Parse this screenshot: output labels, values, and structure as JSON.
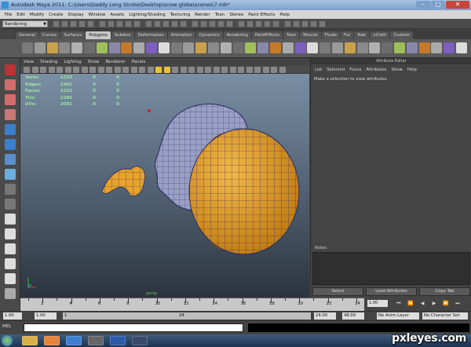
{
  "window": {
    "title": "Autodesk Maya 2011: C:\\Users\\Daddy Long Stroke\\Desktop\\snow globe\\scenes\\7.mb*",
    "minimize": "–",
    "maximize": "▢",
    "close": "✕"
  },
  "menubar": [
    "File",
    "Edit",
    "Modify",
    "Create",
    "Display",
    "Window",
    "Assets",
    "Lighting/Shading",
    "Texturing",
    "Render",
    "Toon",
    "Stereo",
    "Paint Effects",
    "Help"
  ],
  "statusline": {
    "mode": "Rendering"
  },
  "shelf_tabs": [
    {
      "label": "General",
      "active": false
    },
    {
      "label": "Curves",
      "active": false
    },
    {
      "label": "Surfaces",
      "active": false
    },
    {
      "label": "Polygons",
      "active": true
    },
    {
      "label": "Subdivs",
      "active": false
    },
    {
      "label": "Deformation",
      "active": false
    },
    {
      "label": "Animation",
      "active": false
    },
    {
      "label": "Dynamics",
      "active": false
    },
    {
      "label": "Rendering",
      "active": false
    },
    {
      "label": "PaintEffects",
      "active": false
    },
    {
      "label": "Toon",
      "active": false
    },
    {
      "label": "Muscle",
      "active": false
    },
    {
      "label": "Fluids",
      "active": false
    },
    {
      "label": "Fur",
      "active": false
    },
    {
      "label": "Hair",
      "active": false
    },
    {
      "label": "nCloth",
      "active": false
    },
    {
      "label": "Custom",
      "active": false
    }
  ],
  "panel_menu": [
    "View",
    "Shading",
    "Lighting",
    "Show",
    "Renderer",
    "Panels"
  ],
  "hud": [
    {
      "label": "Verts:",
      "v1": "1220",
      "v2": "0",
      "v3": "0"
    },
    {
      "label": "Edges:",
      "v1": "2462",
      "v2": "0",
      "v3": "0"
    },
    {
      "label": "Faces:",
      "v1": "1222",
      "v2": "0",
      "v3": "0"
    },
    {
      "label": "Tris:",
      "v1": "2286",
      "v2": "0",
      "v3": "0"
    },
    {
      "label": "UVs:",
      "v1": "2001",
      "v2": "0",
      "v3": "0"
    }
  ],
  "viewport_footer": "persp",
  "attribute_editor": {
    "title": "Attribute Editor",
    "menu": [
      "List",
      "Selected",
      "Focus",
      "Attributes",
      "Show",
      "Help"
    ],
    "message": "Make a selection to view attributes",
    "notes_label": "Notes:",
    "buttons": [
      "Select",
      "Load Attributes",
      "Copy Tab"
    ]
  },
  "timeslider": {
    "ticks": [
      "2",
      "4",
      "6",
      "8",
      "10",
      "12",
      "14",
      "16",
      "18",
      "20",
      "22",
      "24"
    ]
  },
  "playback": {
    "current_frame": "1.00",
    "buttons": [
      "⏮",
      "⏪",
      "◀",
      "▶",
      "⏩",
      "⏭"
    ]
  },
  "range": {
    "start": "1.00",
    "current": "1.00",
    "slider_start": "1",
    "slider_end": "24",
    "end": "24.00",
    "max": "48.00",
    "anim_layer": "No Anim Layer",
    "char_set": "No Character Set"
  },
  "commandline": {
    "label": "MEL"
  },
  "watermark": "pxleyes.com",
  "colors": {
    "globe": "#e8a32a",
    "wire": "#2a2a60",
    "head": "#9aa0c4"
  }
}
